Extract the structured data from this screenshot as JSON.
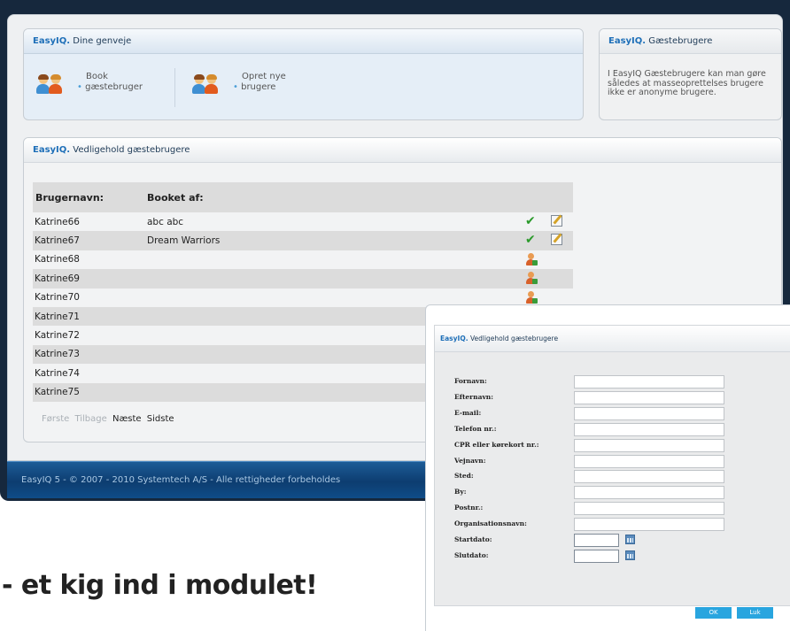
{
  "brand": "EasyIQ.",
  "colors": {
    "accent": "#1e6fb8",
    "footer": "#0d3d70",
    "button": "#29a5df",
    "check": "#2b9a2b"
  },
  "shortcuts": {
    "title": "Dine genveje",
    "items": [
      {
        "line1": "Book",
        "line2": "gæstebruger",
        "icon": "users-icon"
      },
      {
        "line1": "Opret nye",
        "line2": "brugere",
        "icon": "users-icon"
      }
    ],
    "bullet": "•"
  },
  "guests": {
    "title": "Gæstebrugere",
    "description": "I EasyIQ Gæstebrugere kan man gøre således at masseoprettelses brugere ikke er anonyme brugere."
  },
  "maintain": {
    "title": "Vedligehold gæstebrugere",
    "columns": [
      "Brugernavn:",
      "Booket af:"
    ],
    "rows": [
      {
        "user": "Katrine66",
        "booked_by": "abc abc",
        "status": "booked"
      },
      {
        "user": "Katrine67",
        "booked_by": "Dream Warriors",
        "status": "booked"
      },
      {
        "user": "Katrine68",
        "booked_by": "",
        "status": "free"
      },
      {
        "user": "Katrine69",
        "booked_by": "",
        "status": "free"
      },
      {
        "user": "Katrine70",
        "booked_by": "",
        "status": "free"
      },
      {
        "user": "Katrine71",
        "booked_by": "",
        "status": ""
      },
      {
        "user": "Katrine72",
        "booked_by": "",
        "status": ""
      },
      {
        "user": "Katrine73",
        "booked_by": "",
        "status": ""
      },
      {
        "user": "Katrine74",
        "booked_by": "",
        "status": ""
      },
      {
        "user": "Katrine75",
        "booked_by": "",
        "status": ""
      }
    ],
    "pager": {
      "first": "Første",
      "prev": "Tilbage",
      "next": "Næste",
      "last": "Sidste"
    },
    "check_glyph": "✔"
  },
  "footer": {
    "text": "EasyIQ 5 - © 2007 - 2010 Systemtech A/S - Alle rettigheder forbeholdes"
  },
  "dialog": {
    "title": "Vedligehold gæstebrugere",
    "fields": [
      {
        "label": "Fornavn:",
        "value": ""
      },
      {
        "label": "Efternavn:",
        "value": ""
      },
      {
        "label": "E-mail:",
        "value": ""
      },
      {
        "label": "Telefon nr.:",
        "value": ""
      },
      {
        "label": "CPR eller kørekort nr.:",
        "value": ""
      },
      {
        "label": "Vejnavn:",
        "value": ""
      },
      {
        "label": "Sted:",
        "value": ""
      },
      {
        "label": "By:",
        "value": ""
      },
      {
        "label": "Postnr.:",
        "value": ""
      },
      {
        "label": "Organisationsnavn:",
        "value": ""
      },
      {
        "label": "Startdato:",
        "value": "",
        "type": "date"
      },
      {
        "label": "Slutdato:",
        "value": "",
        "type": "date"
      }
    ],
    "ok_label": "OK",
    "close_label": "Luk"
  },
  "tagline": "- et kig ind i modulet!"
}
